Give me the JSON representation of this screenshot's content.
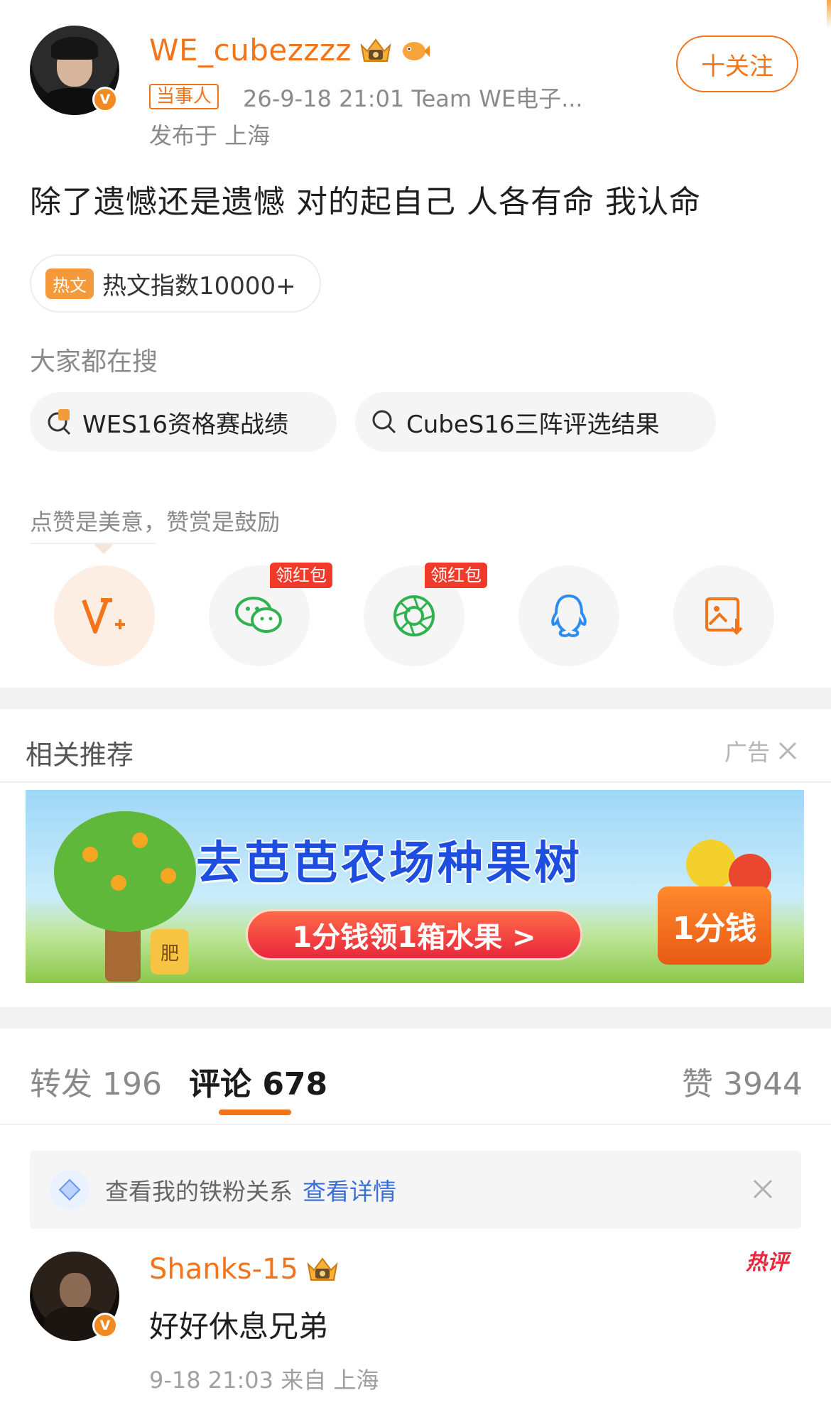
{
  "post": {
    "username": "WE_cubezzzz",
    "role_tag": "当事人",
    "meta": "26-9-18 21:01  Team WE电子...",
    "location": "发布于 上海",
    "follow_label": "十关注",
    "text": "除了遗憾还是遗憾 对的起自己 人各有命 我认命",
    "hot_tag": "热文",
    "hot_text": "热文指数10000+"
  },
  "search": {
    "title": "大家都在搜",
    "chips": [
      "WES16资格赛战绩",
      "CubeS16三阵评选结果"
    ]
  },
  "reward": {
    "tip": "点赞是美意，赞赏是鼓励",
    "red_tag": "领红包"
  },
  "recommend": {
    "title": "相关推荐",
    "ad_label": "广告",
    "banner_title": "去芭芭农场种果树",
    "banner_cta": "1分钱领1箱水果 >",
    "banner_box": "1分钱",
    "banner_bag": "肥"
  },
  "tabs": {
    "repost": "转发 196",
    "comment": "评论 678",
    "like": "赞 3944"
  },
  "fan_bar": {
    "text": "查看我的铁粉关系",
    "link": "查看详情"
  },
  "comment": {
    "username": "Shanks-15",
    "text": "好好休息兄弟",
    "meta": "9-18 21:03 来自 上海",
    "hot_label": "热评"
  },
  "colors": {
    "brand_orange": "#f2741b",
    "link_blue": "#3a6fd8",
    "hot_red": "#e8283a"
  }
}
